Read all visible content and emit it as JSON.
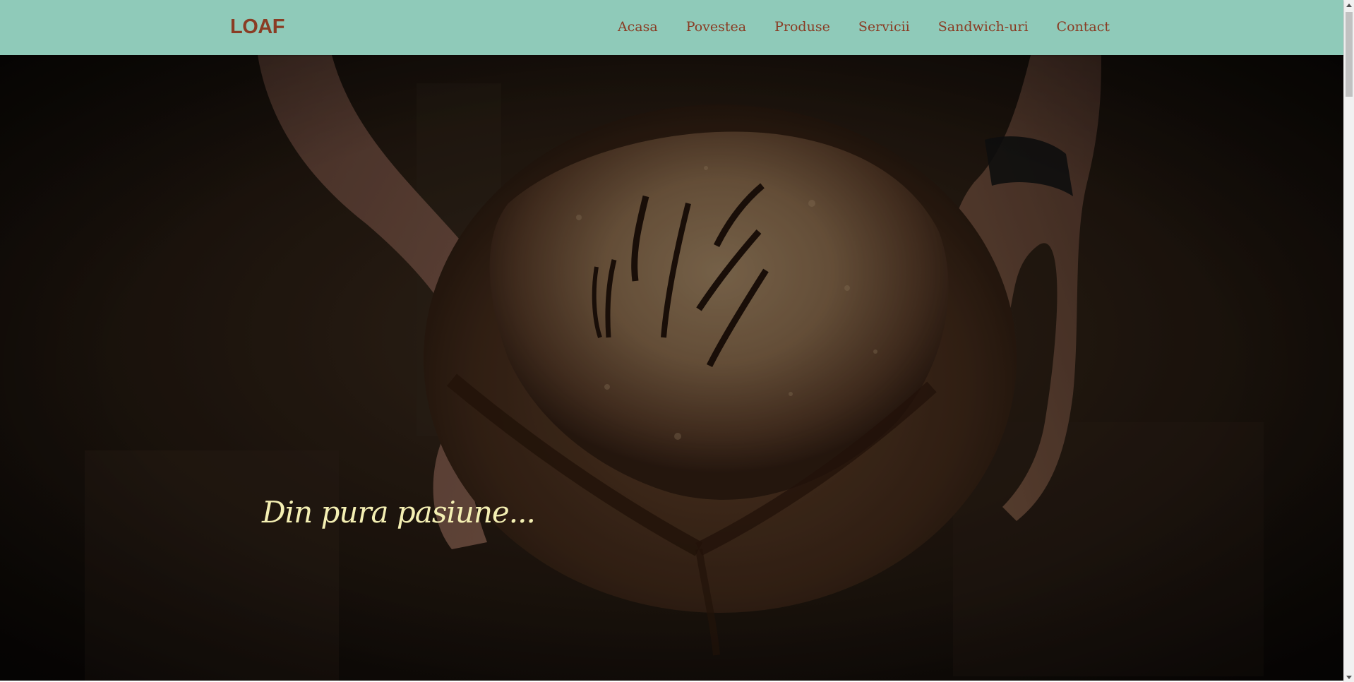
{
  "header": {
    "logo": "LOAF",
    "nav": [
      "Acasa",
      "Povestea",
      "Produse",
      "Servicii",
      "Sandwich-uri",
      "Contact"
    ]
  },
  "hero": {
    "tagline": "Din pura pasiune..."
  },
  "colors": {
    "header_bg": "#8fcab9",
    "brand": "#8a3c24",
    "tagline": "#f4efb3"
  }
}
